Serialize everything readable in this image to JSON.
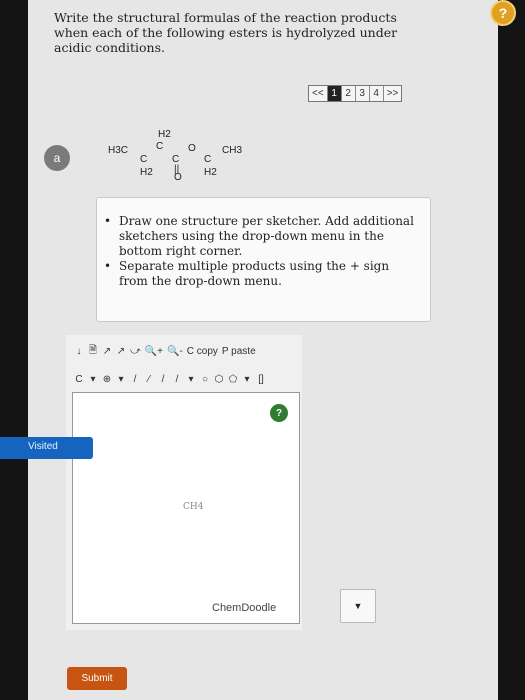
{
  "question": {
    "text": "Write the structural formulas of the reaction products when each of the following esters is hydrolyzed under acidic conditions."
  },
  "pager": {
    "prev": "<<",
    "pages": [
      "1",
      "2",
      "3",
      "4"
    ],
    "active_page": "1",
    "next": ">>"
  },
  "part": {
    "label": "a",
    "structure": {
      "h2_top": "H2",
      "h3c": "H3C",
      "c1": "C",
      "c_mid": "C",
      "c2": "C",
      "o_ester": "O",
      "c3": "C",
      "ch3": "CH3",
      "h2_bottom_left": "H2",
      "o_carbonyl": "O",
      "h2_bottom_right": "H2",
      "double_bond": "||"
    }
  },
  "instructions": {
    "items": [
      "Draw one structure per sketcher. Add additional sketchers using the drop-down menu in the bottom right corner.",
      "Separate multiple products using the + sign from the drop-down menu."
    ]
  },
  "sketcher": {
    "toolbar_row1": [
      "↓",
      "🗎",
      "↗",
      "↗",
      "⤻",
      "🔍+",
      "🔍-",
      "C copy",
      "P paste"
    ],
    "toolbar_row2": [
      "C",
      "▾",
      "⊕",
      "▾",
      "/",
      "⁄",
      "/",
      "/",
      "▾",
      "○",
      "⬡",
      "⬠",
      "▾",
      "[]"
    ],
    "help_label": "?",
    "canvas_hint": "CH4",
    "brand": "ChemDoodle",
    "dropdown_arrow": "▼"
  },
  "side_tab": {
    "label": "Visited"
  },
  "submit": {
    "label": "Submit"
  },
  "help_icon": {
    "label": "?"
  },
  "colors": {
    "submit": "#c75410",
    "visited_tab": "#1565c0",
    "help_icon": "#e0a020",
    "help_bubble": "#2e7d32"
  }
}
